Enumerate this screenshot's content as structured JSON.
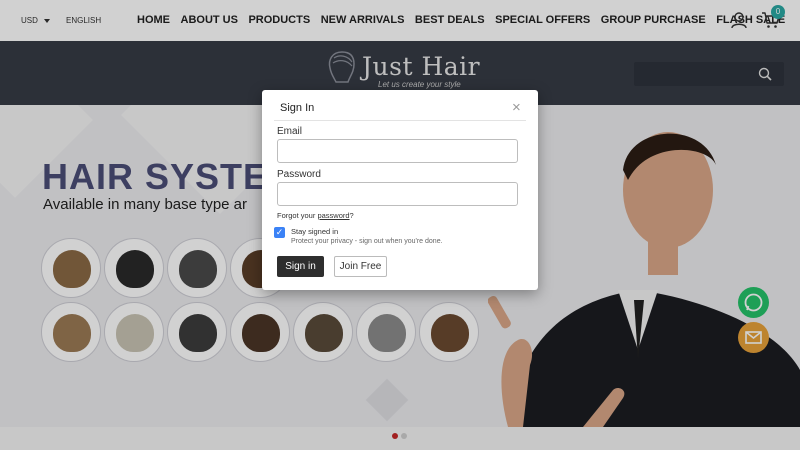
{
  "header": {
    "currency": "USD",
    "language": "ENGLISH",
    "nav": [
      "HOME",
      "ABOUT US",
      "PRODUCTS",
      "NEW ARRIVALS",
      "BEST DEALS",
      "SPECIAL OFFERS",
      "GROUP PURCHASE",
      "FLASH SALE"
    ],
    "cart_count": "0",
    "icons": {
      "account": "user-icon",
      "cart": "cart-icon"
    }
  },
  "brand": {
    "name": "Just Hair",
    "tagline": "Let us create your style"
  },
  "hero": {
    "title": "HAIR SYSTE",
    "subtitle": "Available in many base type ar",
    "swatch_colors": [
      "#8a6a45",
      "#2a2a2a",
      "#4a4a4a",
      "#5a3d28",
      "#9b7a55",
      "#c9c4b4",
      "#3c3c3c",
      "#4b3526",
      "#5a4b3a",
      "#8c8c8c",
      "#6b4a30"
    ],
    "active_slide": 1,
    "slide_count": 2
  },
  "floating": {
    "whatsapp_icon": "whatsapp-icon",
    "mail_icon": "mail-icon"
  },
  "signin_modal": {
    "title": "Sign In",
    "close_glyph": "×",
    "email_label": "Email",
    "email_value": "",
    "password_label": "Password",
    "password_value": "",
    "forgot_prefix": "Forgot your ",
    "forgot_link": "password",
    "forgot_suffix": "?",
    "stay_signed_in_label": "Stay signed in",
    "stay_signed_in_checked": true,
    "privacy_note": "Protect your privacy - sign out when you're done.",
    "signin_button": "Sign in",
    "join_button": "Join Free"
  },
  "colors": {
    "accent_teal": "#2aa8a3",
    "band": "#363b45",
    "hero_title": "#4b4e77",
    "whatsapp": "#25c26a",
    "mail": "#e7a23a",
    "active_dot": "#c62828",
    "checkbox": "#3b82f6"
  }
}
